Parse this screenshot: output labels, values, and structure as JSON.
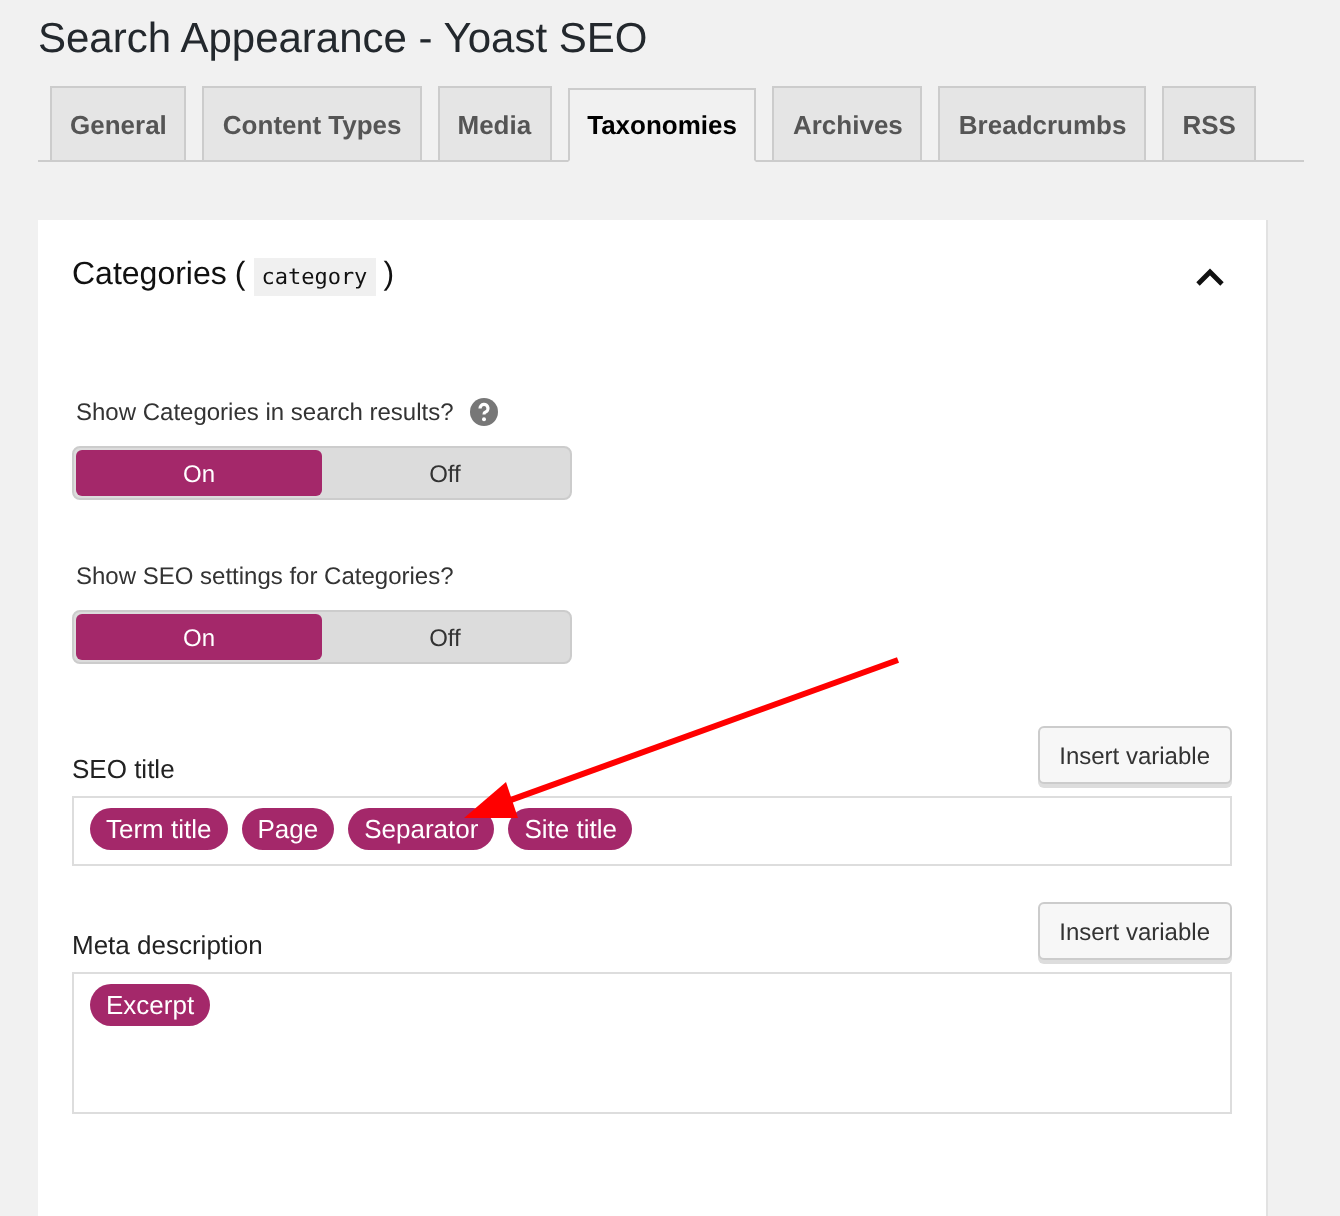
{
  "page_title": "Search Appearance - Yoast SEO",
  "tabs": [
    {
      "label": "General",
      "selected": false
    },
    {
      "label": "Content Types",
      "selected": false
    },
    {
      "label": "Media",
      "selected": false
    },
    {
      "label": "Taxonomies",
      "selected": true
    },
    {
      "label": "Archives",
      "selected": false
    },
    {
      "label": "Breadcrumbs",
      "selected": false
    },
    {
      "label": "RSS",
      "selected": false
    }
  ],
  "section": {
    "title": "Categories",
    "code": "category",
    "expanded": true,
    "paren_open": "(",
    "paren_close": ")"
  },
  "toggles": [
    {
      "label": "Show Categories in search results?",
      "help": true,
      "options": [
        {
          "label": "On",
          "selected": true
        },
        {
          "label": "Off",
          "selected": false
        }
      ]
    },
    {
      "label": "Show SEO settings for Categories?",
      "help": false,
      "options": [
        {
          "label": "On",
          "selected": true
        },
        {
          "label": "Off",
          "selected": false
        }
      ]
    }
  ],
  "editors": [
    {
      "label": "SEO title",
      "button": "Insert variable",
      "kind": "single",
      "tags": [
        "Term title",
        "Page",
        "Separator",
        "Site title"
      ]
    },
    {
      "label": "Meta description",
      "button": "Insert variable",
      "kind": "multi",
      "tags": [
        "Excerpt"
      ]
    }
  ]
}
